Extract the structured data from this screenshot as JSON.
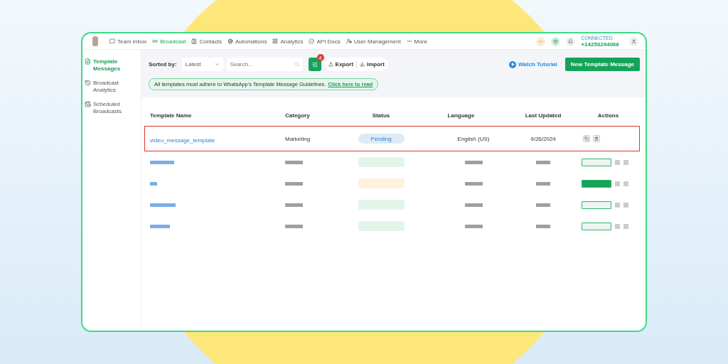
{
  "nav": {
    "items": [
      {
        "label": "Team Inbox",
        "selected": false
      },
      {
        "label": "Broadcast",
        "selected": true
      },
      {
        "label": "Contacts",
        "selected": false
      },
      {
        "label": "Automations",
        "selected": false
      },
      {
        "label": "Analytics",
        "selected": false
      },
      {
        "label": "API Docs",
        "selected": false
      },
      {
        "label": "User Management",
        "selected": false
      },
      {
        "label": "More",
        "selected": false
      }
    ],
    "status": "CONNECTED",
    "phone": "+14253294066"
  },
  "sidebar": {
    "items": [
      {
        "label": "Template Messages",
        "selected": true
      },
      {
        "label": "Broadcast Analytics",
        "selected": false
      },
      {
        "label": "Scheduled Broadcasts",
        "selected": false
      }
    ]
  },
  "toolbar": {
    "sort_label": "Sorted by:",
    "sort_value": "Latest",
    "search_placeholder": "Search...",
    "filter_badge": "4",
    "export": "Export",
    "import": "Import",
    "tutorial": "Watch Tutorial",
    "new_button": "New Template Message"
  },
  "notice": {
    "text": "All templates must adhere to WhatsApp's Template Message Guidelines.",
    "link": "Click here to read"
  },
  "table": {
    "columns": [
      "Template Name",
      "Category",
      "Status",
      "Language",
      "Last Updated",
      "Actions"
    ],
    "rows": [
      {
        "name": "video_message_template",
        "category": "Marketing",
        "status": "Pending",
        "language": "English (US)",
        "updated": "9/26/2024",
        "highlighted": true
      }
    ],
    "redacted_rows": [
      {
        "color": "#e3f5e9",
        "kind": "outline"
      },
      {
        "color": "#fff1dc",
        "kind": "solid"
      },
      {
        "color": "#e3f5e9",
        "kind": "outline"
      },
      {
        "color": "#e3f5e9",
        "kind": "outline"
      }
    ]
  }
}
